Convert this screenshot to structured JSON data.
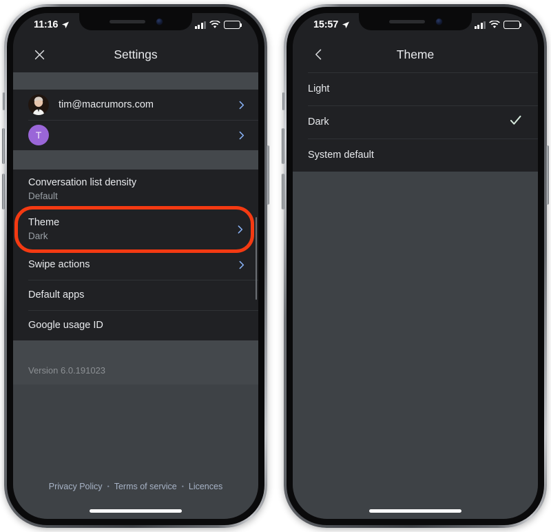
{
  "phones": {
    "left": {
      "status": {
        "time": "11:16",
        "location_icon": "location-arrow-icon",
        "signal_icon": "cellular-signal-icon",
        "wifi_icon": "wifi-icon",
        "battery_icon": "battery-icon"
      },
      "appbar": {
        "close_icon": "close-icon",
        "title": "Settings"
      },
      "accounts": [
        {
          "name": "account-row-email",
          "avatar_type": "photo",
          "avatar_letter": "",
          "label": "tim@macrumors.com",
          "chevron": "chevron-right-icon"
        },
        {
          "name": "account-row-secondary",
          "avatar_type": "letter",
          "avatar_letter": "T",
          "label": "",
          "chevron": "chevron-right-icon"
        }
      ],
      "settings": [
        {
          "name": "setting-conversation-list-density",
          "title": "Conversation list density",
          "subtitle": "Default",
          "chevron": false,
          "highlighted": false
        },
        {
          "name": "setting-theme",
          "title": "Theme",
          "subtitle": "Dark",
          "chevron": true,
          "highlighted": true
        },
        {
          "name": "setting-swipe-actions",
          "title": "Swipe actions",
          "subtitle": "",
          "chevron": true,
          "highlighted": false
        },
        {
          "name": "setting-default-apps",
          "title": "Default apps",
          "subtitle": "",
          "chevron": false,
          "highlighted": false
        },
        {
          "name": "setting-google-usage-id",
          "title": "Google usage ID",
          "subtitle": "",
          "chevron": false,
          "highlighted": false
        }
      ],
      "version": "Version 6.0.191023",
      "footer": {
        "privacy": "Privacy Policy",
        "separator": "•",
        "terms": "Terms of service",
        "licences": "Licences"
      }
    },
    "right": {
      "status": {
        "time": "15:57",
        "location_icon": "location-arrow-icon",
        "signal_icon": "cellular-signal-icon",
        "wifi_icon": "wifi-icon",
        "battery_icon": "battery-icon"
      },
      "appbar": {
        "back_icon": "chevron-left-icon",
        "title": "Theme"
      },
      "options": [
        {
          "name": "theme-option-light",
          "label": "Light",
          "selected": false
        },
        {
          "name": "theme-option-dark",
          "label": "Dark",
          "selected": true
        },
        {
          "name": "theme-option-system-default",
          "label": "System default",
          "selected": false
        }
      ],
      "check_icon": "check-icon"
    }
  },
  "colors": {
    "surface": "#202124",
    "background": "#44488c",
    "accent_blue": "#8ab4f8",
    "highlight_red": "#f43a12",
    "check_green": "#d6eadd",
    "avatar_purple": "#9a66d8"
  }
}
